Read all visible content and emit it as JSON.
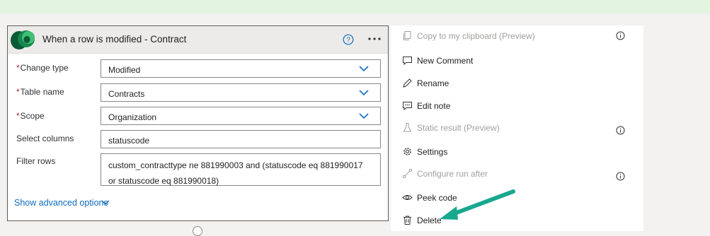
{
  "card": {
    "title": "When a row is modified - Contract",
    "fields": {
      "change_type": {
        "required_mark": "*",
        "label": "Change type",
        "value": "Modified"
      },
      "table_name": {
        "required_mark": "*",
        "label": "Table name",
        "value": "Contracts"
      },
      "scope": {
        "required_mark": "*",
        "label": "Scope",
        "value": "Organization"
      },
      "select_columns": {
        "label": "Select columns",
        "value": "statuscode"
      },
      "filter_rows": {
        "label": "Filter rows",
        "value": "custom_contracttype ne 881990003 and (statuscode eq 881990017 or statuscode eq 881990018)"
      }
    },
    "advanced_link": "Show advanced options"
  },
  "menu": {
    "items": [
      {
        "label": "Copy to my clipboard (Preview)",
        "icon": "copy-icon",
        "disabled": true,
        "info": true
      },
      {
        "label": "New Comment",
        "icon": "comment-icon",
        "disabled": false
      },
      {
        "label": "Rename",
        "icon": "pencil-icon",
        "disabled": false
      },
      {
        "label": "Edit note",
        "icon": "note-icon",
        "disabled": false
      },
      {
        "label": "Static result (Preview)",
        "icon": "flask-icon",
        "disabled": true,
        "info": true
      },
      {
        "label": "Settings",
        "icon": "gear-icon",
        "disabled": false
      },
      {
        "label": "Configure run after",
        "icon": "run-after-icon",
        "disabled": true,
        "info": true
      },
      {
        "label": "Peek code",
        "icon": "eye-icon",
        "disabled": false
      },
      {
        "label": "Delete",
        "icon": "trash-icon",
        "disabled": false
      }
    ]
  },
  "colors": {
    "accent": "#0f6cbd",
    "required": "#a4262c",
    "annotation_arrow": "#18a88e",
    "banner": "#e3f5e1"
  }
}
